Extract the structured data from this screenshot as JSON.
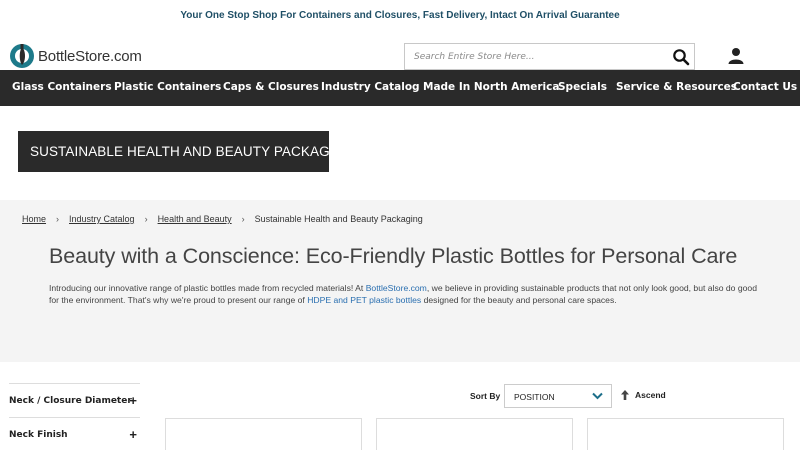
{
  "promo": {
    "text": "Your One Stop Shop For Containers and Closures, Fast Delivery, Intact On Arrival Guarantee"
  },
  "header": {
    "logo_text": "BottleStore.com",
    "search_placeholder": "Search Entire Store Here...",
    "icons": {
      "search": "search-icon",
      "account": "user-account-icon",
      "logo": "bottle-logo-icon"
    }
  },
  "nav": {
    "items": [
      {
        "label": "Glass Containers"
      },
      {
        "label": "Plastic Containers"
      },
      {
        "label": "Caps & Closures"
      },
      {
        "label": "Industry Catalog"
      },
      {
        "label": "Made In North America"
      },
      {
        "label": "Specials"
      },
      {
        "label": "Service & Resources"
      },
      {
        "label": "Contact Us"
      }
    ]
  },
  "banner": {
    "title": "SUSTAINABLE HEALTH AND BEAUTY PACKAGING"
  },
  "breadcrumb": {
    "items": [
      {
        "label": "Home"
      },
      {
        "label": "Industry Catalog"
      },
      {
        "label": "Health and Beauty"
      },
      {
        "label": "Sustainable Health and Beauty Packaging"
      }
    ],
    "separator": "›"
  },
  "content": {
    "heading": "Beauty with a Conscience: Eco-Friendly Plastic Bottles for Personal Care",
    "intro_part1": "Introducing our innovative range of plastic bottles made from recycled materials! At ",
    "intro_link1": "BottleStore.com",
    "intro_part2": ", we believe in providing sustainable products that not only look good, but also do good for the environment. That's why we're proud to present our range of ",
    "intro_link2": "HDPE and PET plastic bottles",
    "intro_part3": " designed for the beauty and personal care spaces."
  },
  "filters": {
    "items": [
      {
        "label": "Neck / Closure Diameter",
        "toggle": "+"
      },
      {
        "label": "Neck Finish",
        "toggle": "+"
      }
    ]
  },
  "sort": {
    "label": "Sort By",
    "selected": "POSITION",
    "direction": "Ascend"
  },
  "colors": {
    "nav_bg": "#2a2a2a",
    "promo_text": "#1f4f66",
    "link": "#2a6fb0",
    "logo_teal": "#1d7a8a",
    "section_bg": "#f4f4f4"
  }
}
